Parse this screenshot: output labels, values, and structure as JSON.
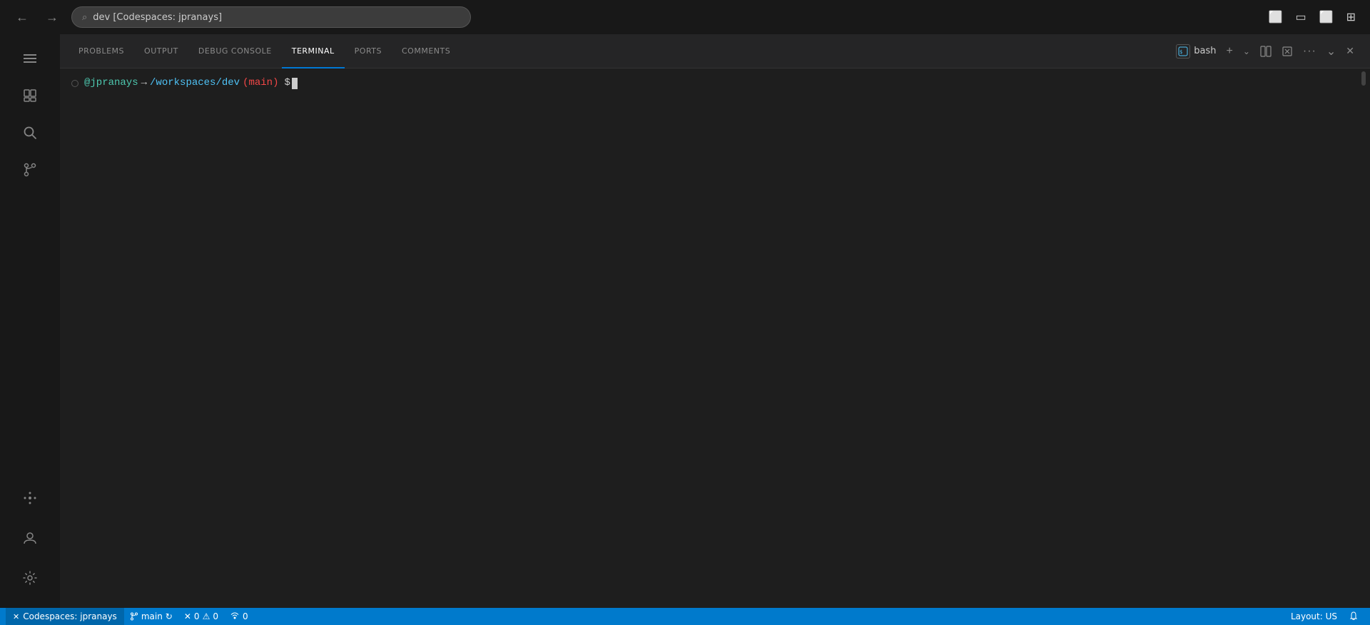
{
  "titlebar": {
    "search_placeholder": "dev [Codespaces: jpranays]",
    "back_icon": "←",
    "forward_icon": "→"
  },
  "activity_bar": {
    "menu_icon": "☰",
    "explorer_icon": "⧉",
    "search_icon": "🔍",
    "source_control_icon": "⎇",
    "extensions_icon": "⋯",
    "account_icon": "◯",
    "settings_icon": "⚙"
  },
  "panel": {
    "tabs": [
      {
        "id": "problems",
        "label": "PROBLEMS"
      },
      {
        "id": "output",
        "label": "OUTPUT"
      },
      {
        "id": "debug-console",
        "label": "DEBUG CONSOLE"
      },
      {
        "id": "terminal",
        "label": "TERMINAL",
        "active": true
      },
      {
        "id": "ports",
        "label": "PORTS"
      },
      {
        "id": "comments",
        "label": "COMMENTS"
      }
    ],
    "bash_label": "bash",
    "add_icon": "+",
    "chevron_down_icon": "∨",
    "split_icon": "⊟",
    "trash_icon": "🗑",
    "more_icon": "⋯",
    "chevron_down2_icon": "∨",
    "close_icon": "✕"
  },
  "terminal": {
    "username": "@jpranays",
    "arrow": "→",
    "path": "/workspaces/dev",
    "branch_open": "(",
    "branch": "main",
    "branch_close": ")",
    "prompt": "$"
  },
  "status_bar": {
    "codespace_icon": "✕",
    "codespace_label": "Codespaces: jpranays",
    "branch_label": "main",
    "sync_icon": "↻",
    "error_icon": "✕",
    "error_count": "0",
    "warning_icon": "⚠",
    "warning_count": "0",
    "broadcast_icon": "📡",
    "broadcast_count": "0",
    "layout_label": "Layout: US",
    "bell_icon": "🔔"
  }
}
